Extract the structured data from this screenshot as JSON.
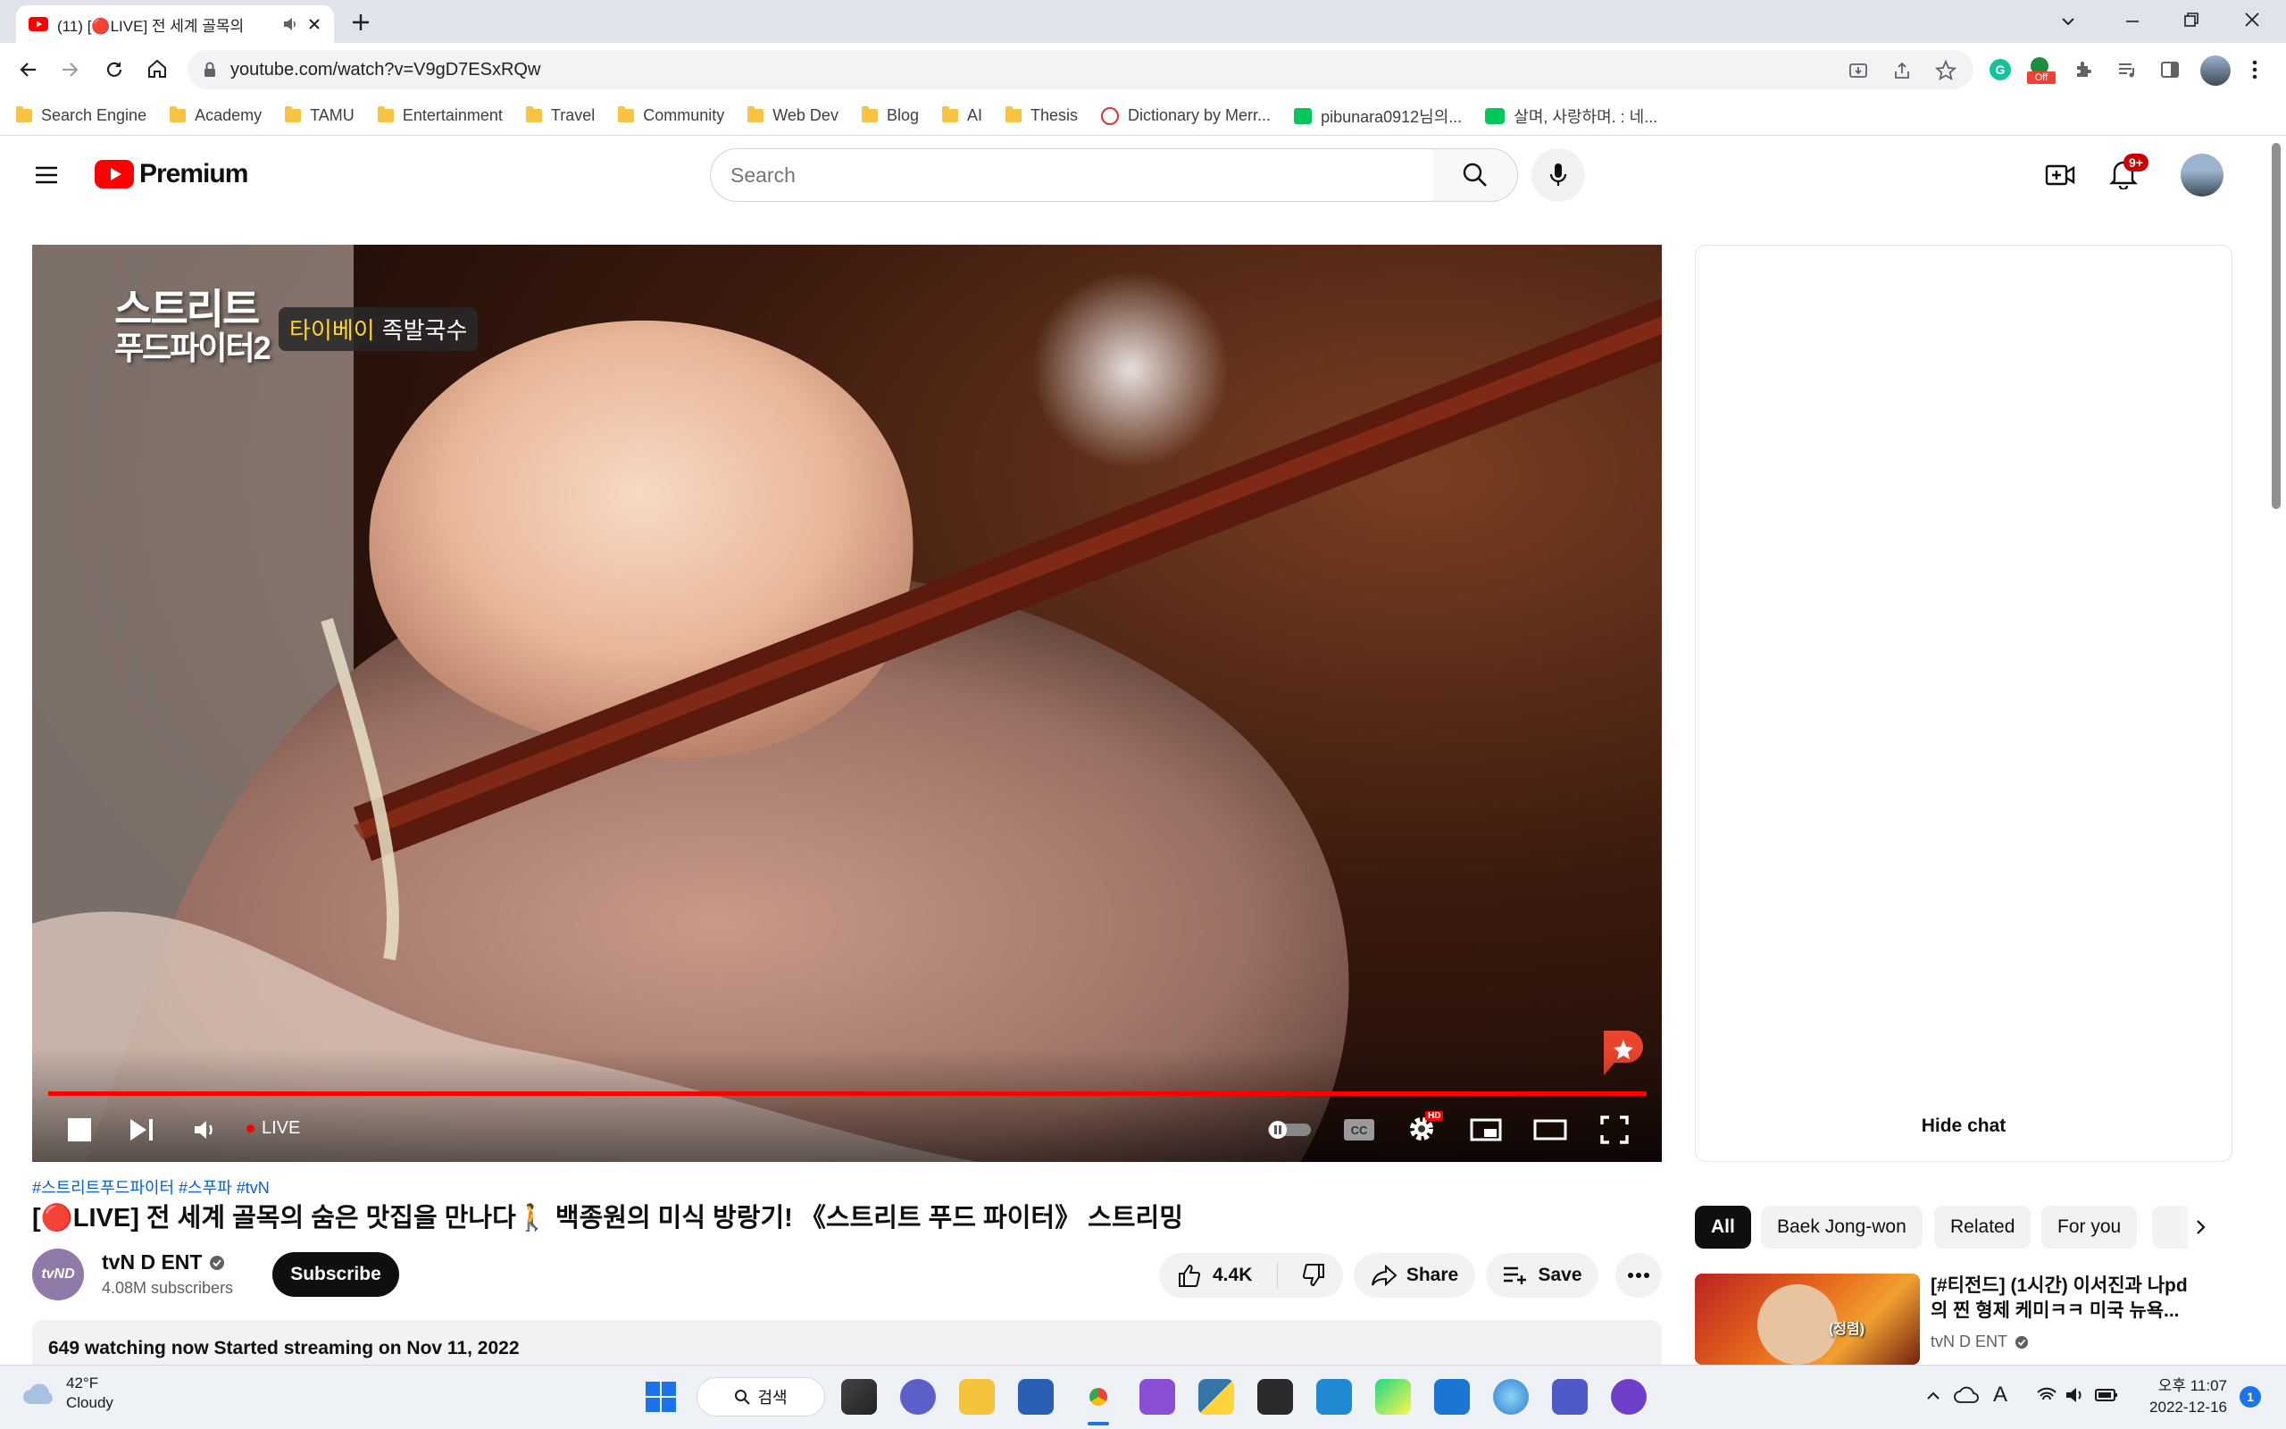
{
  "browser": {
    "tab_title": "(11) [🔴LIVE] 전 세계 골목의",
    "url": "youtube.com/watch?v=V9gD7ESxRQw",
    "extension_badge": "Off",
    "bookmarks": [
      {
        "label": "Search Engine",
        "icon": "folder-icon"
      },
      {
        "label": "Academy",
        "icon": "folder-icon"
      },
      {
        "label": "TAMU",
        "icon": "folder-icon"
      },
      {
        "label": "Entertainment",
        "icon": "folder-icon"
      },
      {
        "label": "Travel",
        "icon": "folder-icon"
      },
      {
        "label": "Community",
        "icon": "folder-icon"
      },
      {
        "label": "Web Dev",
        "icon": "folder-icon"
      },
      {
        "label": "Blog",
        "icon": "folder-icon"
      },
      {
        "label": "AI",
        "icon": "folder-icon"
      },
      {
        "label": "Thesis",
        "icon": "folder-icon"
      },
      {
        "label": "Dictionary by Merr...",
        "icon": "merriam-webster-icon"
      },
      {
        "label": "pibunara0912님의...",
        "icon": "naver-icon"
      },
      {
        "label": "살며, 사랑하며. : 네...",
        "icon": "naver-blog-icon"
      }
    ]
  },
  "youtube": {
    "logo_text": "Premium",
    "search_placeholder": "Search",
    "notification_count": "9+",
    "colors": {
      "accent": "#ff0000",
      "link": "#065fd4"
    }
  },
  "player": {
    "overlay_title_line1": "스트리트",
    "overlay_title_line2": "푸드파이터2",
    "overlay_location": "타이베이",
    "overlay_dish": "족발국수",
    "live_label": "LIVE",
    "hd_badge": "HD",
    "progress": 1.0
  },
  "chat": {
    "hide_label": "Hide chat"
  },
  "video": {
    "hashtags": "#스트리트푸드파이터 #스푸파 #tvN",
    "title": "[🔴LIVE] 전 세계 골목의 숨은 맛집을 만나다🚶 백종원의 미식 방랑기! 《스트리트 푸드 파이터》 스트리밍",
    "channel_avatar_text": "tvND",
    "channel_name": "tvN D ENT",
    "subscribers": "4.08M subscribers",
    "subscribe_label": "Subscribe",
    "likes": "4.4K",
    "share_label": "Share",
    "save_label": "Save",
    "description": "649 watching now  Started streaming on Nov 11, 2022"
  },
  "recommendations": {
    "chips": [
      "All",
      "Baek Jong-won",
      "Related",
      "For you"
    ],
    "items": [
      {
        "title_line1": "[#티전드] (1시간) 이서진과 나pd",
        "title_line2": "의 찐 형제 케미ㅋㅋ 미국 뉴욕...",
        "channel": "tvN D ENT",
        "thumb_caption": "(정렴)"
      }
    ]
  },
  "taskbar": {
    "weather_temp": "42°F",
    "weather_text": "Cloudy",
    "search_label": "검색",
    "ime_label": "A",
    "time": "오후 11:07",
    "date": "2022-12-16",
    "notification_count": "1"
  }
}
